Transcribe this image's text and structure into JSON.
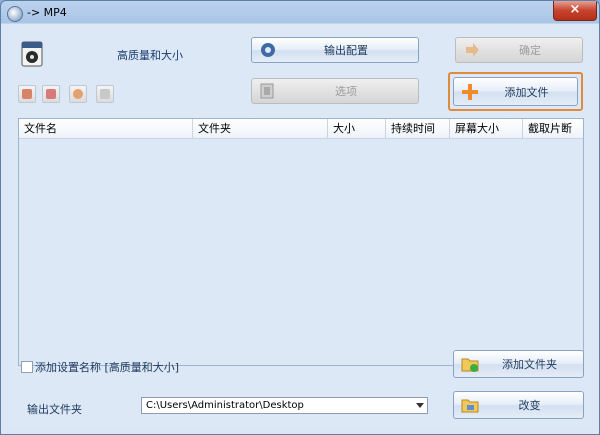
{
  "window": {
    "title": "-> MP4",
    "close_glyph": "×"
  },
  "profile": {
    "icon": "mp4-icon",
    "name": "高质量和大小"
  },
  "buttons": {
    "output_config": "输出配置",
    "ok": "确定",
    "options": "选项",
    "add_file": "添加文件",
    "add_folder": "添加文件夹",
    "change": "改变"
  },
  "toolbar_icons": [
    "clear-list-icon",
    "remove-icon",
    "play-icon",
    "media-info-icon"
  ],
  "file_list": {
    "columns": [
      "文件名",
      "文件夹",
      "大小",
      "持续时间",
      "屏幕大小",
      "截取片断"
    ]
  },
  "options": {
    "append_setting_name_label": "添加设置名称 [高质量和大小]",
    "append_setting_name_checked": false
  },
  "output_folder": {
    "label": "输出文件夹",
    "value": "C:\\Users\\Administrator\\Desktop"
  },
  "colors": {
    "accent_orange": "#e08a3c",
    "window_bg": "#dce8f6",
    "close_red": "#c7432d"
  }
}
